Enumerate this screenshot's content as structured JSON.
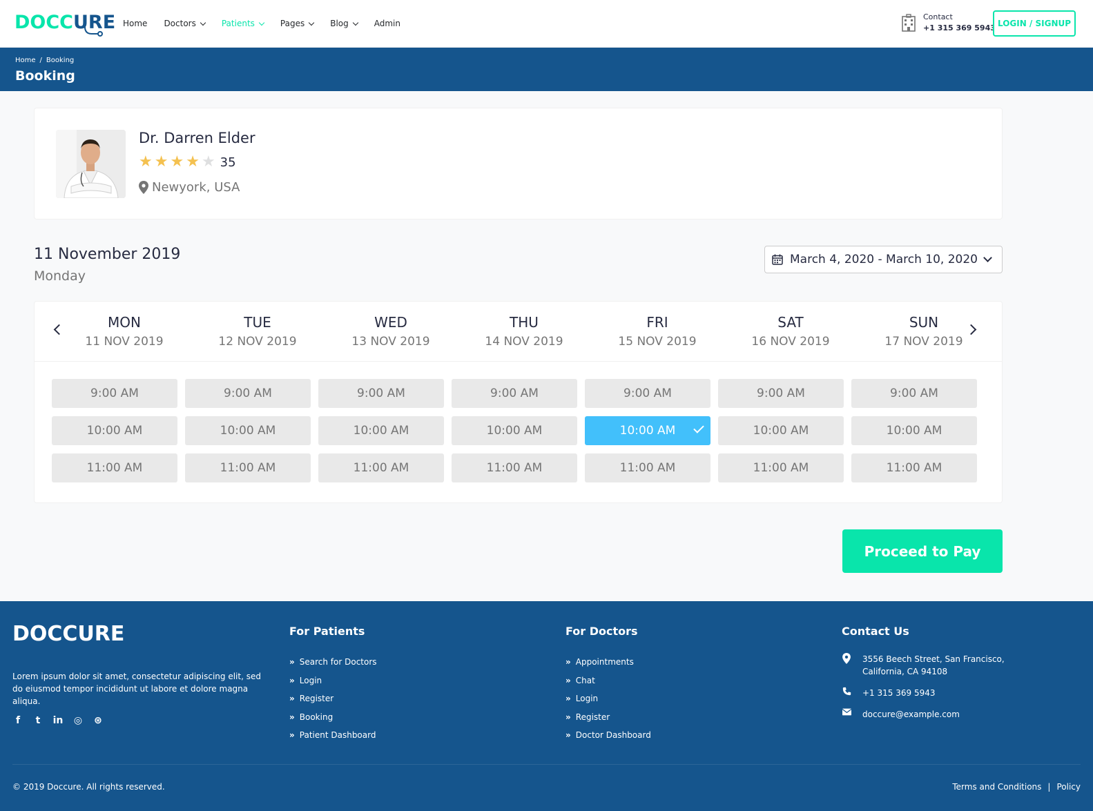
{
  "header": {
    "logo": {
      "part1": "DOCC",
      "part2": "URE"
    },
    "nav": [
      {
        "label": "Home",
        "dropdown": false,
        "active": false
      },
      {
        "label": "Doctors",
        "dropdown": true,
        "active": false
      },
      {
        "label": "Patients",
        "dropdown": true,
        "active": true
      },
      {
        "label": "Pages",
        "dropdown": true,
        "active": false
      },
      {
        "label": "Blog",
        "dropdown": true,
        "active": false
      },
      {
        "label": "Admin",
        "dropdown": false,
        "active": false
      }
    ],
    "contact_label": "Contact",
    "contact_phone": "+1 315 369 5943",
    "login_label": "LOGIN / SIGNUP"
  },
  "breadcrumb": {
    "items": [
      "Home",
      "Booking"
    ],
    "separator": "/",
    "title": "Booking"
  },
  "doctor": {
    "name": "Dr. Darren Elder",
    "rating": 4,
    "rating_max": 5,
    "review_count": "35",
    "location": "Newyork, USA"
  },
  "selected_date": {
    "date": "11 November 2019",
    "day": "Monday"
  },
  "date_range": "March 4, 2020 - March 10, 2020",
  "schedule": {
    "days": [
      {
        "name": "MON",
        "date": "11 NOV 2019"
      },
      {
        "name": "TUE",
        "date": "12 NOV 2019"
      },
      {
        "name": "WED",
        "date": "13 NOV 2019"
      },
      {
        "name": "THU",
        "date": "14 NOV 2019"
      },
      {
        "name": "FRI",
        "date": "15 NOV 2019"
      },
      {
        "name": "SAT",
        "date": "16 NOV 2019"
      },
      {
        "name": "SUN",
        "date": "17 NOV 2019"
      }
    ],
    "times": [
      "9:00 AM",
      "10:00 AM",
      "11:00 AM"
    ],
    "selected": {
      "day": "FRI",
      "time": "10:00 AM"
    }
  },
  "pay_label": "Proceed to Pay",
  "footer": {
    "logo": "DOCCURE",
    "about": "Lorem ipsum dolor sit amet, consectetur adipiscing elit, sed do eiusmod tempor incididunt ut labore et dolore magna aliqua.",
    "social": [
      "facebook-icon",
      "twitter-icon",
      "linkedin-icon",
      "instagram-icon",
      "dribbble-icon"
    ],
    "patients": {
      "title": "For Patients",
      "links": [
        "Search for Doctors",
        "Login",
        "Register",
        "Booking",
        "Patient Dashboard"
      ]
    },
    "doctors": {
      "title": "For Doctors",
      "links": [
        "Appointments",
        "Chat",
        "Login",
        "Register",
        "Doctor Dashboard"
      ]
    },
    "contact": {
      "title": "Contact Us",
      "address_line1": "3556 Beech Street, San Francisco,",
      "address_line2": "California, CA 94108",
      "phone": "+1 315 369 5943",
      "email": "doccure@example.com"
    },
    "copyright": "© 2019 Doccure. All rights reserved.",
    "terms": "Terms and Conditions",
    "separator": "|",
    "policy": "Policy"
  },
  "colors": {
    "brand_blue": "#15558d",
    "accent_green": "#09e5ab",
    "selected_slot": "#42c0fb",
    "star": "#f4c150"
  }
}
